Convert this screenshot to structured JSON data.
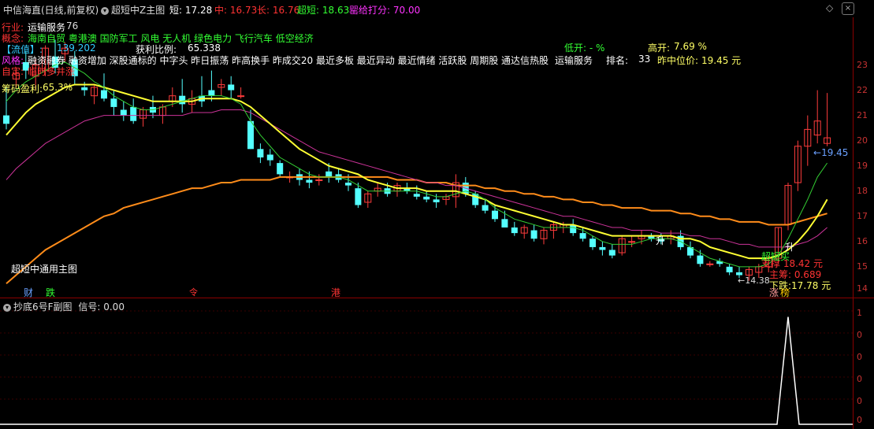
{
  "header": {
    "stock_title": "中信海直(日线,前复权)",
    "indicator_name": "超短中Z主图",
    "items": [
      {
        "label": "短: 17.28",
        "color": "#ffffff"
      },
      {
        "label": "中: 16.73",
        "color": "#ff3333"
      },
      {
        "label": "长: 16.76",
        "color": "#ff3333"
      },
      {
        "label": "超短: 18.63",
        "color": "#33ff33"
      },
      {
        "label": "罂给打分: 70.00",
        "color": "#ff33ff"
      }
    ]
  },
  "info": {
    "industry_label": "行业:",
    "industry_value": "运输服务",
    "industry_num": "76",
    "concept_label": "概念:",
    "concept_value": "海南自贸 粤港澳 国防军工 风电 无人机 绿色电力 飞行汽车 低空经济",
    "float_label": "【流值】:",
    "float_value": "139.202",
    "profit_label": "获利比例:",
    "profit_value": "65.338",
    "low_open_label": "低开: - %",
    "high_open_label": "高开:",
    "high_open_value": "7.69 %",
    "style_label": "风格:",
    "style_value": "融资融券 融资增加 深股通标的 中字头 昨日振荡 昨高换手 昨成交20 最近多板 最近异动 最近情绪 活跃股 周期股 通达信热股",
    "sector": "运输服务",
    "rank_label": "排名:",
    "rank_value": "33",
    "mid_label": "昨中位价:",
    "mid_value": "19.45 元",
    "custom_label": "自定:",
    "custom_value": "临时多井涨",
    "chip_label": "筹码盈利:",
    "chip_value": "65.3%"
  },
  "main_chart": {
    "footer_label": "超短中通用主图",
    "markers": [
      {
        "text": "财",
        "color": "#6aa0ff"
      },
      {
        "text": "跌",
        "color": "#33ff33"
      },
      {
        "text": "令",
        "color": "#ff3333"
      },
      {
        "text": "港",
        "color": "#ff3333"
      },
      {
        "text": "涨",
        "color": "#ff9999"
      },
      {
        "text": "榜",
        "color": "#ffcc00"
      }
    ],
    "annotations": {
      "price_tag": "19.45",
      "low_tag": "14.38",
      "support": "支撑 18.42 元",
      "main_force": "主筹: 0.689",
      "drop": "下跌:17.78 元",
      "short_buy": "超短买",
      "rise": "升",
      "rise2": "升"
    }
  },
  "sub_chart": {
    "title": "抄底6号F副图",
    "signal": "信号: 0.00"
  },
  "axis": {
    "main_ticks": [
      "23",
      "22",
      "21",
      "20",
      "19",
      "18",
      "17",
      "16",
      "15",
      "14"
    ],
    "sub_ticks": [
      "1",
      "0",
      "0",
      "0",
      "0",
      "0"
    ],
    "top_icons": [
      "expand-icon",
      "close-icon"
    ]
  },
  "chart_data": {
    "type": "candlestick",
    "ylim": [
      13.8,
      23.8
    ],
    "candles": [
      [
        20.3,
        21.3,
        19.8,
        20.0
      ],
      [
        21.6,
        22.0,
        21.3,
        21.8
      ],
      [
        22.2,
        22.6,
        21.6,
        21.9
      ],
      [
        21.7,
        22.3,
        21.2,
        22.1
      ],
      [
        21.9,
        22.8,
        21.7,
        22.7
      ],
      [
        22.4,
        23.0,
        21.8,
        22.0
      ],
      [
        22.5,
        22.9,
        22.2,
        22.7
      ],
      [
        22.3,
        22.6,
        21.4,
        21.7
      ],
      [
        21.3,
        21.5,
        21.0,
        21.2
      ],
      [
        21.0,
        21.4,
        20.7,
        21.3
      ],
      [
        21.2,
        21.8,
        20.8,
        20.9
      ],
      [
        20.9,
        21.2,
        20.3,
        20.6
      ],
      [
        20.5,
        20.8,
        20.1,
        20.3
      ],
      [
        20.6,
        20.9,
        20.0,
        20.1
      ],
      [
        20.2,
        20.6,
        19.9,
        20.5
      ],
      [
        20.6,
        21.0,
        20.2,
        20.4
      ],
      [
        20.3,
        20.7,
        20.0,
        20.6
      ],
      [
        20.8,
        21.3,
        20.6,
        21.0
      ],
      [
        21.0,
        21.6,
        20.4,
        20.7
      ],
      [
        20.7,
        21.2,
        20.4,
        20.9
      ],
      [
        21.0,
        21.7,
        20.6,
        20.8
      ],
      [
        21.2,
        21.9,
        20.8,
        21.0
      ],
      [
        21.3,
        21.6,
        21.0,
        21.4
      ],
      [
        21.4,
        21.7,
        20.9,
        21.2
      ],
      [
        21.0,
        21.3,
        20.9,
        21.0
      ],
      [
        20.1,
        20.5,
        19.1,
        19.1
      ],
      [
        19.1,
        19.3,
        18.6,
        18.8
      ],
      [
        18.9,
        19.1,
        18.5,
        18.7
      ],
      [
        18.6,
        18.7,
        18.1,
        18.2
      ],
      [
        18.1,
        18.3,
        17.9,
        18.1
      ],
      [
        18.2,
        18.4,
        17.8,
        18.0
      ],
      [
        18.0,
        18.3,
        17.7,
        17.9
      ],
      [
        18.0,
        18.2,
        17.8,
        18.0
      ],
      [
        18.3,
        18.6,
        17.9,
        18.1
      ],
      [
        18.2,
        18.4,
        17.9,
        18.0
      ],
      [
        17.9,
        18.2,
        17.6,
        17.8
      ],
      [
        17.7,
        17.9,
        17.0,
        17.1
      ],
      [
        17.2,
        17.6,
        17.0,
        17.5
      ],
      [
        17.6,
        17.9,
        17.4,
        17.7
      ],
      [
        17.7,
        17.9,
        17.4,
        17.5
      ],
      [
        17.6,
        17.9,
        17.4,
        17.8
      ],
      [
        17.7,
        17.9,
        17.5,
        17.6
      ],
      [
        17.5,
        17.8,
        17.3,
        17.4
      ],
      [
        17.4,
        17.6,
        17.2,
        17.3
      ],
      [
        17.3,
        17.5,
        17.0,
        17.2
      ],
      [
        17.3,
        17.5,
        17.1,
        17.4
      ],
      [
        17.4,
        18.2,
        17.0,
        17.9
      ],
      [
        17.9,
        18.1,
        17.4,
        17.5
      ],
      [
        17.5,
        17.6,
        17.0,
        17.1
      ],
      [
        17.1,
        17.3,
        16.8,
        16.9
      ],
      [
        16.9,
        17.1,
        16.5,
        16.6
      ],
      [
        16.6,
        16.9,
        16.3,
        16.3
      ],
      [
        16.3,
        16.5,
        16.0,
        16.1
      ],
      [
        16.1,
        16.4,
        15.9,
        16.3
      ],
      [
        16.2,
        16.4,
        15.8,
        15.9
      ],
      [
        15.9,
        16.3,
        15.7,
        16.2
      ],
      [
        16.2,
        16.5,
        15.9,
        16.4
      ],
      [
        16.3,
        16.5,
        16.1,
        16.4
      ],
      [
        16.4,
        16.6,
        16.0,
        16.1
      ],
      [
        16.1,
        16.3,
        15.8,
        15.9
      ],
      [
        15.9,
        16.0,
        15.5,
        15.6
      ],
      [
        15.6,
        15.8,
        15.3,
        15.5
      ],
      [
        15.5,
        15.7,
        15.2,
        15.3
      ],
      [
        15.4,
        16.0,
        15.3,
        15.9
      ],
      [
        15.8,
        16.0,
        15.6,
        15.8
      ],
      [
        15.9,
        16.2,
        15.7,
        16.0
      ],
      [
        16.0,
        16.1,
        15.8,
        15.9
      ],
      [
        15.9,
        16.1,
        15.7,
        15.8
      ],
      [
        15.9,
        16.2,
        15.7,
        16.0
      ],
      [
        16.0,
        16.2,
        15.5,
        15.6
      ],
      [
        15.6,
        15.8,
        15.2,
        15.3
      ],
      [
        15.3,
        15.5,
        14.9,
        15.0
      ],
      [
        15.0,
        15.1,
        14.9,
        15.0
      ],
      [
        15.1,
        15.2,
        14.9,
        15.0
      ],
      [
        14.9,
        15.0,
        14.6,
        14.7
      ],
      [
        14.7,
        14.9,
        14.5,
        14.6
      ],
      [
        14.6,
        14.9,
        14.4,
        14.8
      ],
      [
        14.7,
        15.0,
        14.5,
        14.9
      ],
      [
        14.9,
        15.3,
        14.7,
        15.2
      ],
      [
        15.2,
        16.3,
        15.0,
        16.3
      ],
      [
        16.4,
        17.9,
        16.2,
        17.8
      ],
      [
        17.9,
        19.4,
        17.6,
        19.2
      ],
      [
        19.2,
        20.3,
        18.5,
        19.8
      ],
      [
        19.6,
        21.2,
        19.3,
        20.1
      ],
      [
        19.3,
        21.1,
        19.2,
        19.5
      ]
    ],
    "ma_fast": [
      20.8,
      21.2,
      21.5,
      21.7,
      21.9,
      22.1,
      22.2,
      22.0,
      21.8,
      21.5,
      21.3,
      21.0,
      20.8,
      20.6,
      20.5,
      20.5,
      20.6,
      20.7,
      20.8,
      20.9,
      21.0,
      21.0,
      21.0,
      20.9,
      20.7,
      20.1,
      19.6,
      19.2,
      18.8,
      18.6,
      18.4,
      18.2,
      18.1,
      18.1,
      18.1,
      18.0,
      17.8,
      17.6,
      17.6,
      17.6,
      17.6,
      17.6,
      17.6,
      17.5,
      17.4,
      17.4,
      17.5,
      17.6,
      17.5,
      17.3,
      17.0,
      16.8,
      16.6,
      16.5,
      16.4,
      16.3,
      16.3,
      16.3,
      16.3,
      16.2,
      16.0,
      15.8,
      15.7,
      15.7,
      15.7,
      15.8,
      15.9,
      15.9,
      15.9,
      15.8,
      15.6,
      15.4,
      15.2,
      15.1,
      15.0,
      14.9,
      14.9,
      14.9,
      15.0,
      15.3,
      15.9,
      16.6,
      17.3,
      18.1,
      18.6
    ],
    "ma_short": [
      19.6,
      20.0,
      20.4,
      20.7,
      20.9,
      21.1,
      21.3,
      21.4,
      21.4,
      21.4,
      21.3,
      21.2,
      21.1,
      21.0,
      20.9,
      20.8,
      20.8,
      20.8,
      20.8,
      20.8,
      20.9,
      20.9,
      20.9,
      20.9,
      20.8,
      20.6,
      20.3,
      20.0,
      19.7,
      19.4,
      19.1,
      18.9,
      18.7,
      18.5,
      18.4,
      18.3,
      18.2,
      18.0,
      17.9,
      17.8,
      17.7,
      17.7,
      17.7,
      17.6,
      17.6,
      17.6,
      17.6,
      17.5,
      17.4,
      17.3,
      17.1,
      17.0,
      16.9,
      16.8,
      16.7,
      16.6,
      16.5,
      16.4,
      16.4,
      16.3,
      16.2,
      16.1,
      16.0,
      16.0,
      16.0,
      16.0,
      16.0,
      16.0,
      16.0,
      15.9,
      15.9,
      15.8,
      15.6,
      15.5,
      15.4,
      15.3,
      15.2,
      15.2,
      15.2,
      15.3,
      15.5,
      15.8,
      16.2,
      16.7,
      17.3
    ],
    "ma_mid": [
      18.0,
      18.4,
      18.7,
      19.0,
      19.3,
      19.5,
      19.7,
      19.9,
      20.1,
      20.2,
      20.3,
      20.3,
      20.3,
      20.3,
      20.3,
      20.3,
      20.3,
      20.3,
      20.3,
      20.4,
      20.4,
      20.4,
      20.5,
      20.5,
      20.5,
      20.4,
      20.2,
      20.0,
      19.8,
      19.6,
      19.4,
      19.2,
      19.0,
      18.9,
      18.8,
      18.7,
      18.6,
      18.5,
      18.4,
      18.3,
      18.2,
      18.1,
      18.0,
      17.9,
      17.9,
      17.8,
      17.8,
      17.7,
      17.6,
      17.5,
      17.4,
      17.3,
      17.2,
      17.1,
      17.0,
      16.9,
      16.8,
      16.7,
      16.7,
      16.6,
      16.5,
      16.4,
      16.3,
      16.3,
      16.2,
      16.2,
      16.2,
      16.1,
      16.1,
      16.1,
      16.0,
      16.0,
      15.9,
      15.9,
      15.8,
      15.7,
      15.7,
      15.6,
      15.6,
      15.6,
      15.6,
      15.7,
      15.8,
      16.0,
      16.3
    ],
    "ma_long": [
      14.3,
      14.6,
      14.9,
      15.2,
      15.5,
      15.7,
      15.9,
      16.1,
      16.3,
      16.5,
      16.7,
      16.8,
      17.0,
      17.1,
      17.2,
      17.3,
      17.4,
      17.5,
      17.6,
      17.7,
      17.7,
      17.8,
      17.9,
      17.9,
      18.0,
      18.0,
      18.0,
      18.0,
      18.1,
      18.1,
      18.1,
      18.1,
      18.1,
      18.1,
      18.1,
      18.1,
      18.1,
      18.1,
      18.1,
      18.1,
      18.0,
      18.0,
      18.0,
      17.9,
      17.9,
      17.9,
      17.8,
      17.8,
      17.8,
      17.7,
      17.7,
      17.6,
      17.6,
      17.5,
      17.5,
      17.4,
      17.4,
      17.3,
      17.3,
      17.2,
      17.2,
      17.1,
      17.1,
      17.0,
      17.0,
      17.0,
      16.9,
      16.9,
      16.9,
      16.8,
      16.8,
      16.7,
      16.7,
      16.6,
      16.6,
      16.5,
      16.5,
      16.5,
      16.4,
      16.4,
      16.4,
      16.5,
      16.6,
      16.7,
      16.8
    ],
    "signal": {
      "type": "line",
      "ylim": [
        0,
        1.1
      ],
      "spike_index": 80,
      "values_note_free": true
    }
  }
}
